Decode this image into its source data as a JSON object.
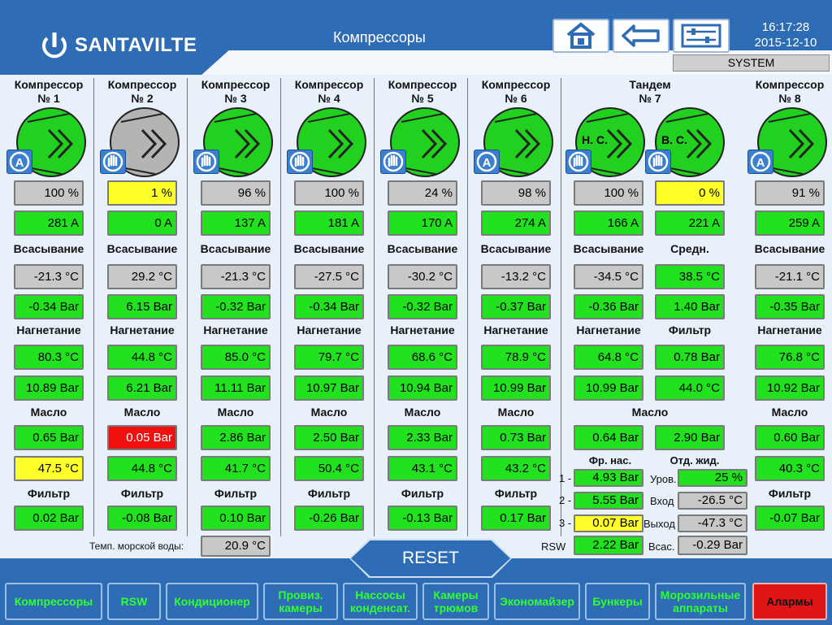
{
  "header": {
    "brand": "SANTAVILTE",
    "title": "Компрессоры",
    "time": "16:17:28",
    "date": "2015-12-10",
    "system": "SYSTEM"
  },
  "labels": {
    "suction": "Всасывание",
    "discharge": "Нагнетание",
    "oil": "Масло",
    "filter": "Фильтр",
    "middle": "Средн.",
    "fr_nas": "Фр. нас.",
    "otd_zhid": "Отд. жид.",
    "sea_temp": "Темп. морской воды:",
    "rsw": "RSW",
    "row1": "1 -",
    "row2": "2 -",
    "row3": "3 -",
    "level": "Уров.",
    "inlet": "Вход",
    "outlet": "Выход",
    "suction_short": "Всас.",
    "hs": "Н. С.",
    "bs": "В. С."
  },
  "compressors": [
    {
      "name1": "Компрессор",
      "name2": "№ 1",
      "state": "running",
      "mode": "auto",
      "load": "100 %",
      "current": "281 A",
      "suction_t": "-21.3 °C",
      "suction_p": "-0.34 Bar",
      "discharge_t": "80.3 °C",
      "discharge_p": "10.89 Bar",
      "oil_p": "0.65 Bar",
      "oil_t": "47.5 °C",
      "filter": "0.02 Bar"
    },
    {
      "name1": "Компрессор",
      "name2": "№ 2",
      "state": "stopped",
      "mode": "manual",
      "load": "1 %",
      "current": "0 A",
      "suction_t": "29.2 °C",
      "suction_p": "6.15 Bar",
      "discharge_t": "44.8 °C",
      "discharge_p": "6.21 Bar",
      "oil_p": "0.05 Bar",
      "oil_t": "44.8 °C",
      "filter": "-0.08 Bar"
    },
    {
      "name1": "Компрессор",
      "name2": "№ 3",
      "state": "running",
      "mode": "manual",
      "load": "96 %",
      "current": "137 A",
      "suction_t": "-21.3 °C",
      "suction_p": "-0.32 Bar",
      "discharge_t": "85.0 °C",
      "discharge_p": "11.11 Bar",
      "oil_p": "2.86 Bar",
      "oil_t": "41.7 °C",
      "filter": "0.10 Bar"
    },
    {
      "name1": "Компрессор",
      "name2": "№ 4",
      "state": "running",
      "mode": "manual",
      "load": "100 %",
      "current": "181 A",
      "suction_t": "-27.5 °C",
      "suction_p": "-0.34 Bar",
      "discharge_t": "79.7 °C",
      "discharge_p": "10.97 Bar",
      "oil_p": "2.50 Bar",
      "oil_t": "50.4 °C",
      "filter": "-0.26 Bar"
    },
    {
      "name1": "Компрессор",
      "name2": "№ 5",
      "state": "running",
      "mode": "manual",
      "load": "24 %",
      "current": "170 A",
      "suction_t": "-30.2 °C",
      "suction_p": "-0.32 Bar",
      "discharge_t": "68.6 °C",
      "discharge_p": "10.94 Bar",
      "oil_p": "2.33 Bar",
      "oil_t": "43.1 °C",
      "filter": "-0.13 Bar"
    },
    {
      "name1": "Компрессор",
      "name2": "№ 6",
      "state": "running",
      "mode": "auto",
      "load": "98 %",
      "current": "274 A",
      "suction_t": "-13.2 °C",
      "suction_p": "-0.37 Bar",
      "discharge_t": "78.9 °C",
      "discharge_p": "10.99 Bar",
      "oil_p": "0.73 Bar",
      "oil_t": "43.2 °C",
      "filter": "0.17 Bar"
    },
    {
      "name1": "Компрессор",
      "name2": "№ 8",
      "state": "running",
      "mode": "auto",
      "load": "91 %",
      "current": "259 A",
      "suction_t": "-21.1 °C",
      "suction_p": "-0.35 Bar",
      "discharge_t": "76.8 °C",
      "discharge_p": "10.92 Bar",
      "oil_p": "0.60 Bar",
      "oil_t": "40.3 °C",
      "filter": "-0.07 Bar"
    }
  ],
  "tandem": {
    "name1": "Тандем",
    "name2": "№ 7",
    "low": {
      "load": "100 %",
      "current": "166 A",
      "suction_t": "-34.5 °C",
      "suction_p": "-0.36 Bar",
      "discharge_t": "64.8 °C",
      "discharge_p": "10.99 Bar",
      "oil_p": "0.64 Bar"
    },
    "high": {
      "load": "0 %",
      "current": "221 A",
      "mid_t": "38.5 °C",
      "mid_p": "1.40 Bar",
      "filter1": "0.78 Bar",
      "filter2": "44.0 °C",
      "oil_p": "2.90 Bar"
    },
    "fr_nas": [
      "4.93 Bar",
      "5.55 Bar",
      "0.07 Bar"
    ],
    "rsw": "2.22 Bar",
    "separator": {
      "level": "25 %",
      "inlet": "-26.5 °C",
      "outlet": "-47.3 °C",
      "suction": "-0.29 Bar"
    }
  },
  "sea_temp_value": "20.9 °C",
  "reset_label": "RESET",
  "nav": [
    {
      "label": "Компрессоры"
    },
    {
      "label": "RSW"
    },
    {
      "label": "Кондиционер"
    },
    {
      "label": "Провиз. камеры"
    },
    {
      "label": "Нассосы конденсат."
    },
    {
      "label": "Камеры трюмов"
    },
    {
      "label": "Экономайзер"
    },
    {
      "label": "Бункеры"
    },
    {
      "label": "Морозильные аппараты"
    },
    {
      "label": "Алармы"
    }
  ],
  "colors": {
    "ok": "#22e21f",
    "warning": "#ffff2a",
    "alarm": "#f01010",
    "neutral": "#c8c8c8",
    "header": "#2e6db6"
  }
}
